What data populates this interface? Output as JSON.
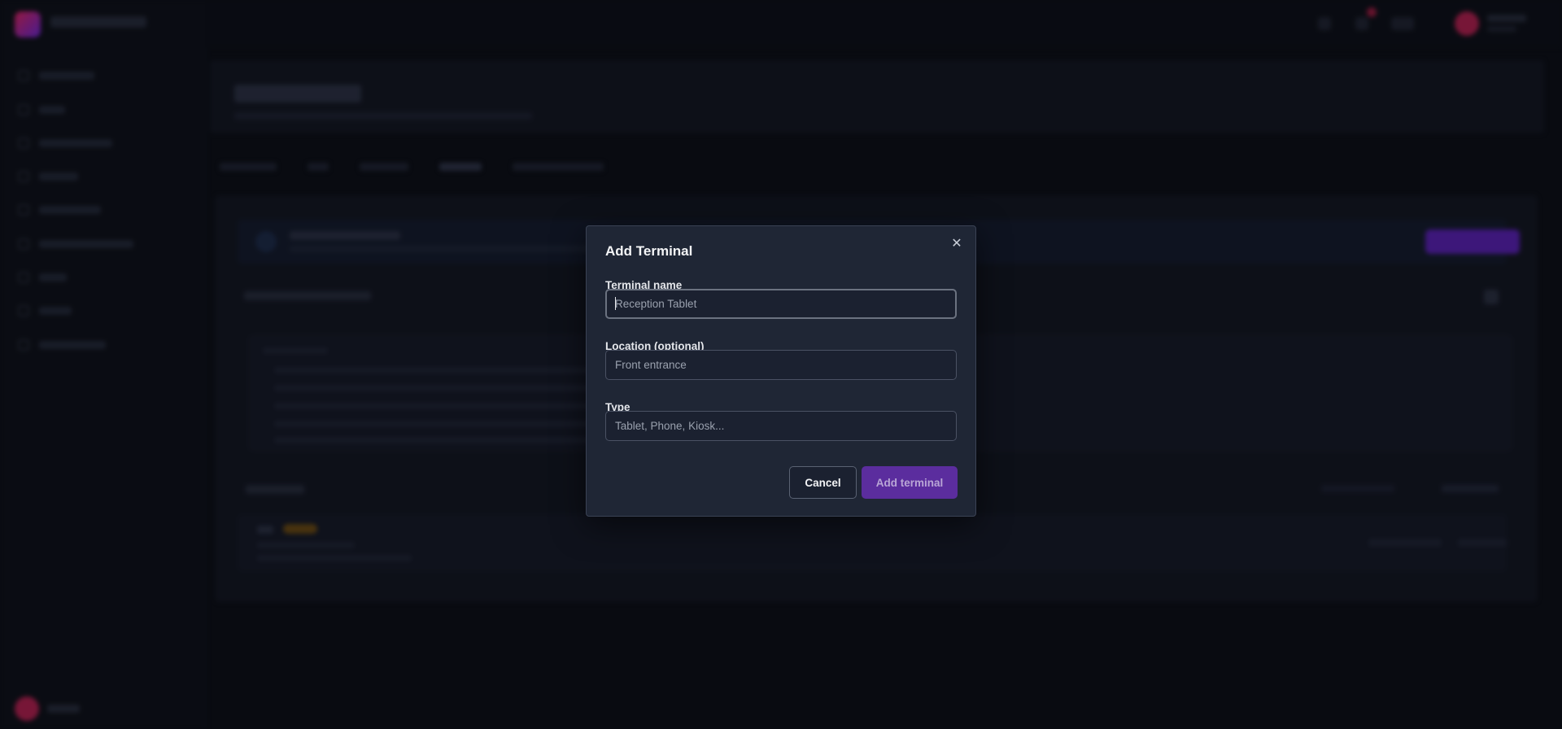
{
  "modal": {
    "title": "Add Terminal",
    "close_icon": "close-icon",
    "fields": [
      {
        "label": "Terminal name",
        "value": "",
        "placeholder": "Reception Tablet"
      },
      {
        "label": "Location (optional)",
        "value": "",
        "placeholder": "Front entrance"
      },
      {
        "label": "Type",
        "value": "",
        "placeholder": "Tablet, Phone, Kiosk..."
      }
    ],
    "cancel_label": "Cancel",
    "submit_label": "Add terminal"
  },
  "colors": {
    "modal_bg": "#1f2635",
    "accent": "#5b2d9e",
    "page_bg": "#0b0e14"
  }
}
